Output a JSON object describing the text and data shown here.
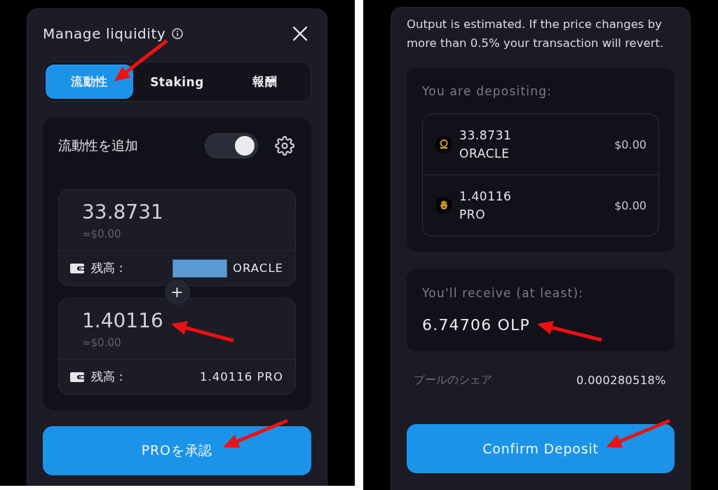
{
  "left_panel": {
    "title": "Manage liquidity",
    "tabs": [
      {
        "label": "流動性",
        "selected": true
      },
      {
        "label": "Staking",
        "selected": false
      },
      {
        "label": "報酬",
        "selected": false
      }
    ],
    "add_liquidity": {
      "title": "流動性を追加",
      "toggle": {
        "on": true
      },
      "inputs": [
        {
          "value": "33.8731",
          "usd": "≈$0.00",
          "balance_label": "残高：",
          "balance_redacted": true,
          "balance": "ORACLE"
        },
        {
          "value": "1.40116",
          "usd": "≈$0.00",
          "balance_label": "残高：",
          "balance_redacted": false,
          "balance": "1.40116 PRO"
        }
      ],
      "separator": "+"
    },
    "button": "PROを承認"
  },
  "right_panel": {
    "notice": "Output is estimated. If the price changes by more than 0.5% your transaction will revert.",
    "depositing": {
      "label": "You are depositing:",
      "tokens": [
        {
          "amount": "33.8731",
          "symbol": "ORACLE",
          "usd": "$0.00"
        },
        {
          "amount": "1.40116",
          "symbol": "PRO",
          "usd": "$0.00"
        }
      ]
    },
    "receive": {
      "label": "You'll receive (at least):",
      "value": "6.74706 OLP"
    },
    "pool_share": {
      "label": "プールのシェア",
      "value": "0.000280518%"
    },
    "button": "Confirm Deposit"
  },
  "annotations": [
    {
      "kind": "arrow"
    },
    {
      "kind": "arrow"
    },
    {
      "kind": "arrow"
    },
    {
      "kind": "arrow"
    },
    {
      "kind": "arrow"
    }
  ]
}
